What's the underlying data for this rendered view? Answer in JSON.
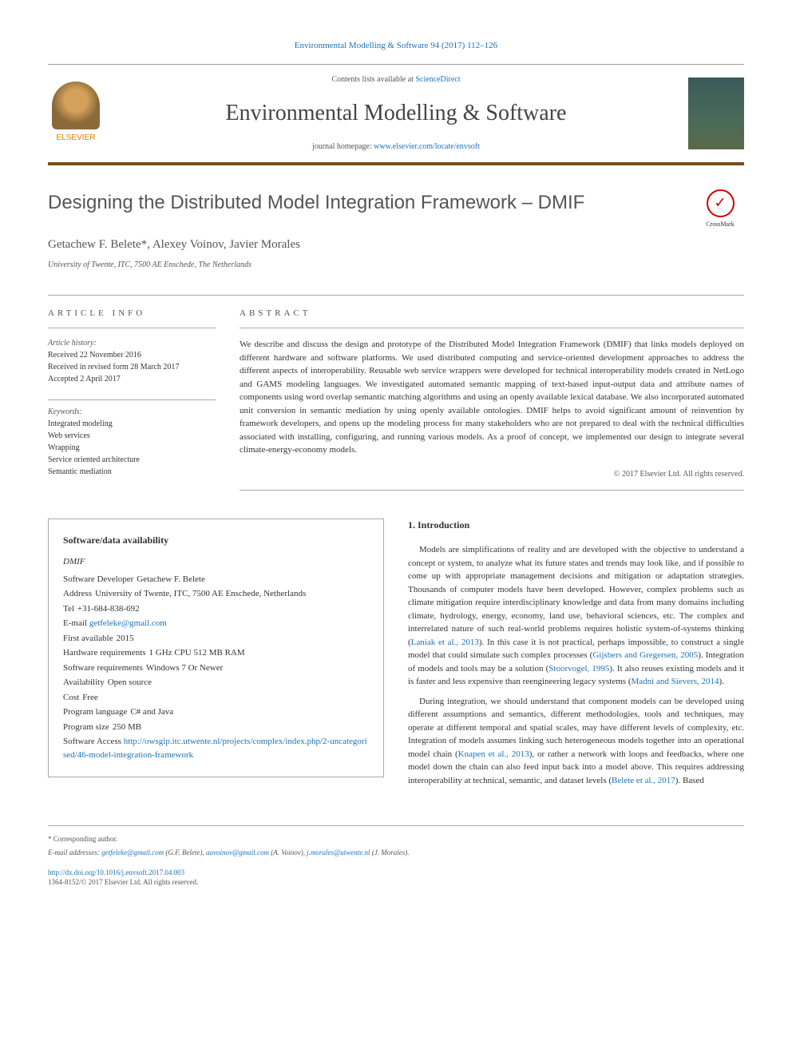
{
  "top_citation": "Environmental Modelling & Software 94 (2017) 112–126",
  "header": {
    "contents_available": "Contents lists available at ",
    "sciencedirect": "ScienceDirect",
    "journal_name": "Environmental Modelling & Software",
    "homepage_label": "journal homepage: ",
    "homepage_url": "www.elsevier.com/locate/envsoft",
    "elsevier": "ELSEVIER"
  },
  "article": {
    "title": "Designing the Distributed Model Integration Framework – DMIF",
    "crossmark": "CrossMark",
    "authors": "Getachew F. Belete*, Alexey Voinov, Javier Morales",
    "affiliation": "University of Twente, ITC, 7500 AE Enschede, The Netherlands"
  },
  "article_info": {
    "label": "ARTICLE INFO",
    "history_label": "Article history:",
    "received": "Received 22 November 2016",
    "revised": "Received in revised form 28 March 2017",
    "accepted": "Accepted 2 April 2017",
    "keywords_label": "Keywords:",
    "keywords": [
      "Integrated modeling",
      "Web services",
      "Wrapping",
      "Service oriented architecture",
      "Semantic mediation"
    ]
  },
  "abstract": {
    "label": "ABSTRACT",
    "text": "We describe and discuss the design and prototype of the Distributed Model Integration Framework (DMIF) that links models deployed on different hardware and software platforms. We used distributed computing and service-oriented development approaches to address the different aspects of interoperability. Reusable web service wrappers were developed for technical interoperability models created in NetLogo and GAMS modeling languages. We investigated automated semantic mapping of text-based input-output data and attribute names of components using word overlap semantic matching algorithms and using an openly available lexical database. We also incorporated automated unit conversion in semantic mediation by using openly available ontologies. DMIF helps to avoid significant amount of reinvention by framework developers, and opens up the modeling process for many stakeholders who are not prepared to deal with the technical difficulties associated with installing, configuring, and running various models. As a proof of concept, we implemented our design to integrate several climate-energy-economy models.",
    "copyright": "© 2017 Elsevier Ltd. All rights reserved."
  },
  "software": {
    "title": "Software/data availability",
    "name": "DMIF",
    "rows": [
      {
        "key": "Software Developer",
        "val": "Getachew F. Belete"
      },
      {
        "key": "Address",
        "val": "University of Twente, ITC, 7500 AE Enschede, Netherlands"
      },
      {
        "key": "Tel",
        "val": "+31-684-838-692"
      },
      {
        "key": "E-mail",
        "val": "getfeleke@gmail.com",
        "link": true
      },
      {
        "key": "First available",
        "val": "2015"
      },
      {
        "key": "Hardware requirements",
        "val": "1 GHz CPU 512 MB RAM"
      },
      {
        "key": "Software requirements",
        "val": "Windows 7 Or Newer"
      },
      {
        "key": "Availability",
        "val": "Open source"
      },
      {
        "key": "Cost",
        "val": "Free"
      },
      {
        "key": "Program language",
        "val": "C# and Java"
      },
      {
        "key": "Program size",
        "val": "250 MB"
      },
      {
        "key": "Software Access",
        "val": "http://owsgip.itc.utwente.nl/projects/complex/index.php/2-uncategorised/46-model-integration-framework",
        "link": true
      }
    ]
  },
  "intro": {
    "title": "1. Introduction",
    "p1_a": "Models are simplifications of reality and are developed with the objective to understand a concept or system, to analyze what its future states and trends may look like, and if possible to come up with appropriate management decisions and mitigation or adaptation strategies. Thousands of computer models have been developed. However, complex problems such as climate mitigation require interdisciplinary knowledge and data from many domains including climate, hydrology, energy, economy, land use, behavioral sciences, etc. The complex and interrelated nature of such real-world problems requires holistic system-of-systems thinking (",
    "p1_c1": "Laniak et al., 2013",
    "p1_b": "). In this case it is not practical, perhaps impossible, to construct a single model that could simulate such complex processes (",
    "p1_c2": "Gijsbers and Gregersen, 2005",
    "p1_c": "). Integration of models and tools may be a solution (",
    "p1_c3": "Stoorvogel, 1995",
    "p1_d": "). It also reuses existing models and it is faster and less expensive than reengineering legacy systems (",
    "p1_c4": "Madni and Sievers, 2014",
    "p1_e": ").",
    "p2_a": "During integration, we should understand that component models can be developed using different assumptions and semantics, different methodologies, tools and techniques, may operate at different temporal and spatial scales, may have different levels of complexity, etc. Integration of models assumes linking such heterogeneous models together into an operational model chain (",
    "p2_c1": "Knapen et al., 2013",
    "p2_b": "), or rather a network with loops and feedbacks, where one model down the chain can also feed input back into a model above. This requires addressing interoperability at technical, semantic, and dataset levels (",
    "p2_c2": "Belete et al., 2017",
    "p2_c": "). Based"
  },
  "footer": {
    "corr_label": "* Corresponding author.",
    "email_label": "E-mail addresses:",
    "email1": "getfeleke@gmail.com",
    "name1": "(G.F. Belete),",
    "email2": "aavoinov@gmail.com",
    "name2": "(A. Voinov),",
    "email3": "j.morales@utwente.nl",
    "name3": "(J. Morales).",
    "doi": "http://dx.doi.org/10.1016/j.envsoft.2017.04.003",
    "issn_copyright": "1364-8152/© 2017 Elsevier Ltd. All rights reserved."
  }
}
